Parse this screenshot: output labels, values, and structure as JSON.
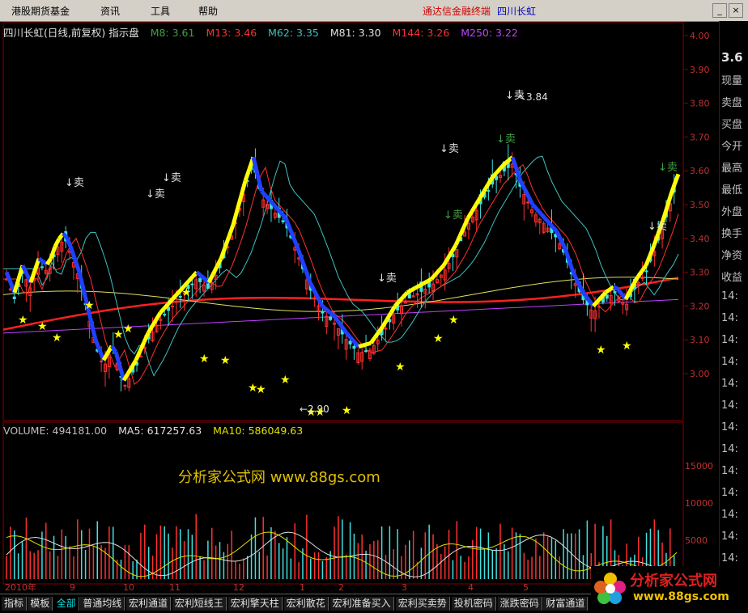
{
  "menu": [
    "港股期货基金",
    "资讯",
    "工具",
    "帮助"
  ],
  "title_bar": {
    "app": "通达信金融终端",
    "stock": "四川长虹"
  },
  "main_legend": {
    "prefix": "四川长虹(日线,前复权) 指示盘",
    "items": [
      {
        "label": "M8: 3.61",
        "color": "#40a040"
      },
      {
        "label": "M13: 3.46",
        "color": "#ff3030"
      },
      {
        "label": "M62: 3.35",
        "color": "#40c0c0"
      },
      {
        "label": "M81: 3.30",
        "color": "#e0e0e0"
      },
      {
        "label": "M144: 3.26",
        "color": "#ff3030"
      },
      {
        "label": "M250: 3.22",
        "color": "#c040ff"
      }
    ]
  },
  "volume_legend": {
    "volume": "VOLUME: 494181.00",
    "ma5": "MA5: 617257.63",
    "ma10": "MA10: 586049.63"
  },
  "price_axis": [
    "4.00",
    "3.90",
    "3.80",
    "3.70",
    "3.60",
    "3.50",
    "3.40",
    "3.30",
    "3.20",
    "3.10",
    "3.00"
  ],
  "volume_axis": [
    "15000",
    "10000",
    "5000"
  ],
  "date_axis": [
    "2010年",
    "9",
    "10",
    "11",
    "12",
    "1",
    "2",
    "3",
    "4",
    "5"
  ],
  "annotations": {
    "sell": "卖",
    "high": "3.84",
    "low": "2.90"
  },
  "right_panel": [
    "3.6",
    "现量",
    "卖盘",
    "买盘",
    "今开",
    "最高",
    "最低",
    "外盘",
    "换手",
    "净资",
    "收益",
    "14:",
    "14:",
    "14:",
    "14:",
    "14:",
    "14:",
    "14:",
    "14:",
    "14:",
    "14:",
    "14:",
    "14:",
    "14:",
    "14:"
  ],
  "watermark": "分析家公式网 www.88gs.com",
  "logo": {
    "name": "分析家公式网",
    "url": "www.88gs.com"
  },
  "tabs": [
    "指标",
    "模板",
    "全部",
    "普通均线",
    "宏利通道",
    "宏利短线王",
    "宏利擎天柱",
    "宏利散花",
    "宏利准备买入",
    "宏利买卖势",
    "投机密码",
    "涨跌密码",
    "财富通道"
  ],
  "active_tab": "全部",
  "colors": {
    "up": "#ff3030",
    "down": "#40e0e0",
    "up_signal": "#ffff00",
    "down_signal": "#2040ff",
    "star": "#ffff00"
  },
  "chart_data": {
    "type": "candlestick",
    "ylim": [
      2.85,
      4.02
    ],
    "low_marker": 2.9,
    "high_marker": 3.84
  }
}
